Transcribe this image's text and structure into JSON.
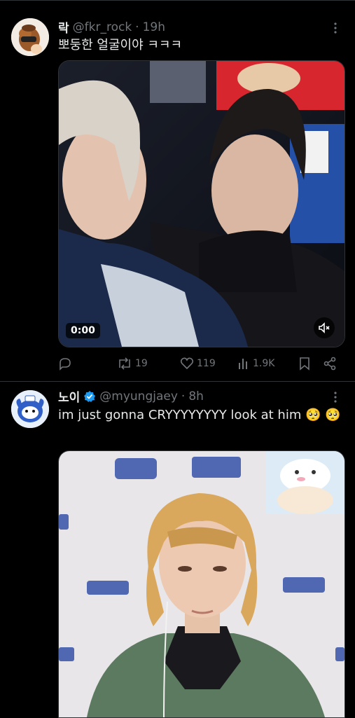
{
  "tweets": [
    {
      "name": "락",
      "handle": "@fkr_rock",
      "separator": "·",
      "time": "19h",
      "text": "뽀둥한 얼굴이야 ㅋㅋㅋ",
      "media": {
        "type": "video",
        "timestamp": "0:00"
      },
      "actions": {
        "retweets": "19",
        "likes": "119",
        "views": "1.9K"
      }
    },
    {
      "name": "노이",
      "verified": true,
      "handle": "@myungjaey",
      "separator": "·",
      "time": "8h",
      "text": "im just gonna CRYYYYYYYY look at him 🥺 🥺",
      "media": {
        "type": "video"
      }
    }
  ],
  "colors": {
    "background": "#000000",
    "muted": "#71767b",
    "verified": "#1d9bf0",
    "divider": "#2f3336"
  },
  "icons": [
    "more-icon",
    "reply-icon",
    "retweet-icon",
    "like-icon",
    "views-icon",
    "bookmark-icon",
    "share-icon",
    "mute-icon",
    "verified-badge-icon"
  ]
}
